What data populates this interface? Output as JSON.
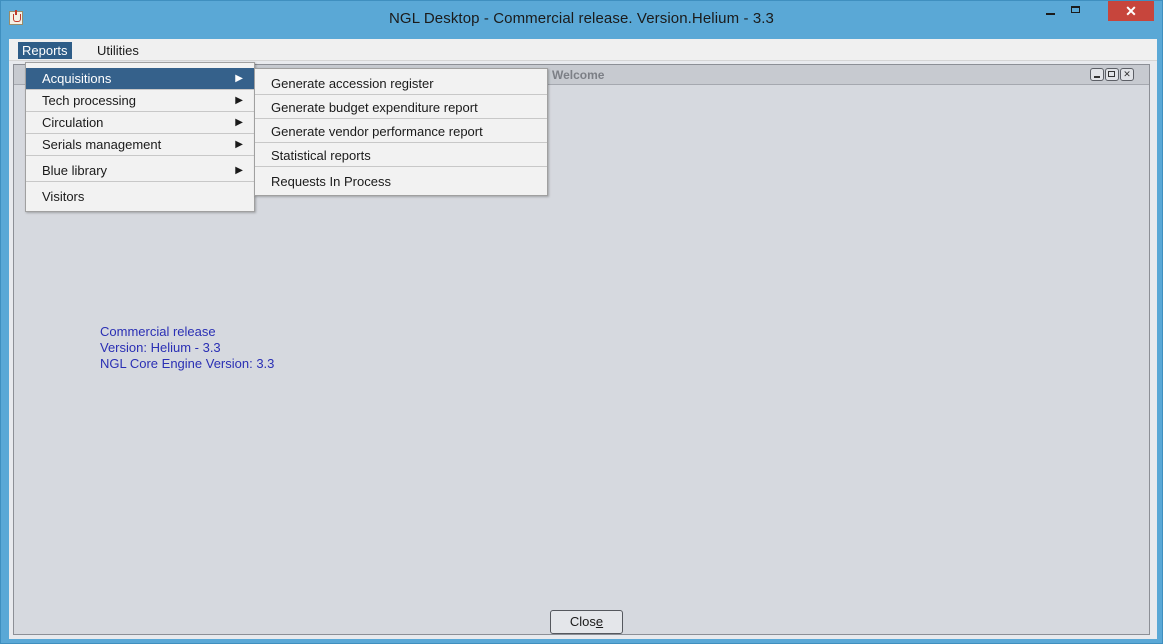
{
  "window": {
    "title": "NGL Desktop - Commercial release. Version.Helium - 3.3",
    "close_glyph": "✕"
  },
  "menubar": {
    "items": [
      {
        "label": "Reports"
      },
      {
        "label": "Utilities"
      }
    ]
  },
  "reports_menu": {
    "items": [
      {
        "label": "Acquisitions",
        "arrow": "▶"
      },
      {
        "label": "Tech processing",
        "arrow": "▶"
      },
      {
        "label": "Circulation",
        "arrow": "▶"
      },
      {
        "label": "Serials management",
        "arrow": "▶"
      },
      {
        "label": "Blue library",
        "arrow": "▶"
      },
      {
        "label": "Visitors"
      }
    ]
  },
  "acquisitions_submenu": {
    "items": [
      {
        "label": "Generate accession register"
      },
      {
        "label": "Generate budget expenditure report"
      },
      {
        "label": "Generate vendor performance report"
      },
      {
        "label": "Statistical reports"
      },
      {
        "label": "Requests In Process"
      }
    ]
  },
  "welcome_frame": {
    "title": "Welcome",
    "close_glyph": "✕",
    "info_lines": [
      "Commercial release",
      "Version: Helium - 3.3",
      "NGL Core Engine Version: 3.3"
    ],
    "close_button": {
      "label_before": "Clos",
      "label_mnemonic": "e",
      "label_after": ""
    }
  }
}
